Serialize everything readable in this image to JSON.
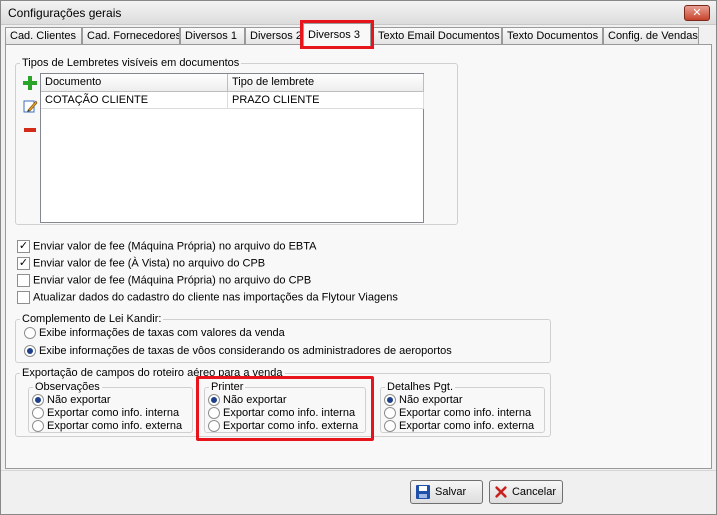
{
  "window": {
    "title": "Configurações gerais",
    "close_label": "✕"
  },
  "tabs": [
    {
      "label": "Cad. Clientes"
    },
    {
      "label": "Cad. Fornecedores"
    },
    {
      "label": "Diversos 1"
    },
    {
      "label": "Diversos 2"
    },
    {
      "label": "Diversos 3",
      "active": true
    },
    {
      "label": "Texto Email Documentos"
    },
    {
      "label": "Texto Documentos"
    },
    {
      "label": "Config. de Vendas"
    }
  ],
  "reminders": {
    "legend": "Tipos de Lembretes visíveis em documentos",
    "columns": [
      "Documento",
      "Tipo de lembrete"
    ],
    "rows": [
      {
        "documento": "COTAÇÃO CLIENTE",
        "tipo": "PRAZO CLIENTE"
      }
    ],
    "tools": {
      "add": "add-icon",
      "edit": "edit-icon",
      "remove": "remove-icon"
    }
  },
  "checkboxes": [
    {
      "label": "Enviar valor de fee (Máquina Própria) no arquivo do EBTA",
      "checked": true
    },
    {
      "label": "Enviar valor de fee (À Vista) no arquivo do CPB",
      "checked": true
    },
    {
      "label": "Enviar valor de fee (Máquina Própria) no arquivo do CPB",
      "checked": false
    },
    {
      "label": "Atualizar dados do cadastro do cliente nas importações da Flytour Viagens",
      "checked": false
    }
  ],
  "lei_kandir": {
    "legend": "Complemento de Lei Kandir:",
    "options": [
      {
        "label": "Exibe informações de taxas com valores da venda",
        "selected": false
      },
      {
        "label": "Exibe informações de taxas de vôos considerando os administradores de aeroportos",
        "selected": true
      }
    ]
  },
  "export": {
    "legend": "Exportação de campos do roteiro aéreo para a venda",
    "groups": [
      {
        "legend": "Observações",
        "options": [
          "Não exportar",
          "Exportar como info. interna",
          "Exportar como info. externa"
        ],
        "selected": 0
      },
      {
        "legend": "Printer",
        "options": [
          "Não exportar",
          "Exportar como info. interna",
          "Exportar como info. externa"
        ],
        "selected": 0
      },
      {
        "legend": "Detalhes Pgt.",
        "options": [
          "Não exportar",
          "Exportar como info. interna",
          "Exportar como info. externa"
        ],
        "selected": 0
      }
    ]
  },
  "buttons": {
    "save": "Salvar",
    "cancel": "Cancelar"
  },
  "colors": {
    "highlight": "#e8141b",
    "add": "#2aa52a",
    "remove": "#d42a1a"
  }
}
